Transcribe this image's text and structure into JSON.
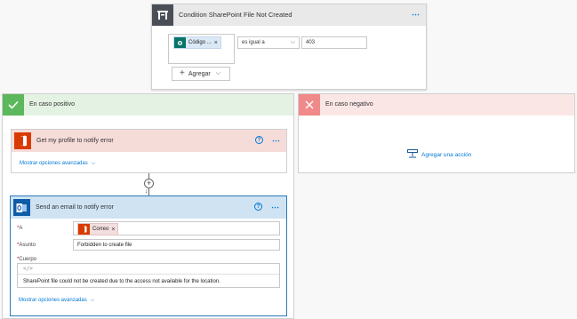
{
  "condition": {
    "title": "Condition SharePoint File Not Created",
    "more": "⋯",
    "token_label": "Código ...",
    "token_close": "×",
    "operator": "es igual a",
    "operator_chevron": "⌵",
    "value": "403",
    "add_label": "Agregar",
    "add_plus": "+",
    "add_chevron": "⌵"
  },
  "branch_yes": {
    "title": "En caso positivo"
  },
  "branch_no": {
    "title": "En caso negativo",
    "add_action": "Agregar una acción"
  },
  "profile_action": {
    "title": "Get my profile to notify error",
    "help": "?",
    "more": "⋯",
    "advanced": "Mostrar opciones avanzadas",
    "advanced_chevron": "⌵"
  },
  "connector": {
    "plus": "+",
    "arrow": "↓"
  },
  "email_action": {
    "title": "Send an email to notify error",
    "help": "?",
    "more": "⋯",
    "to_label": "A",
    "to_token": "Correo",
    "to_token_close": "×",
    "subject_label": "Asunto",
    "subject_value": "Forbidden to create file",
    "body_label": "Cuerpo",
    "body_code_icon": "</>",
    "body_value": "SharePoint file could not be created due to the access not available for the location.",
    "required_mark": "*",
    "advanced": "Mostrar opciones avanzadas",
    "advanced_chevron": "⌵"
  },
  "colors": {
    "accent": "#0078d4",
    "condition_icon": "#4a4f57",
    "yes": "#5cb85c",
    "no": "#f08989",
    "office": "#d83b01",
    "outlook": "#0f5ca8"
  }
}
